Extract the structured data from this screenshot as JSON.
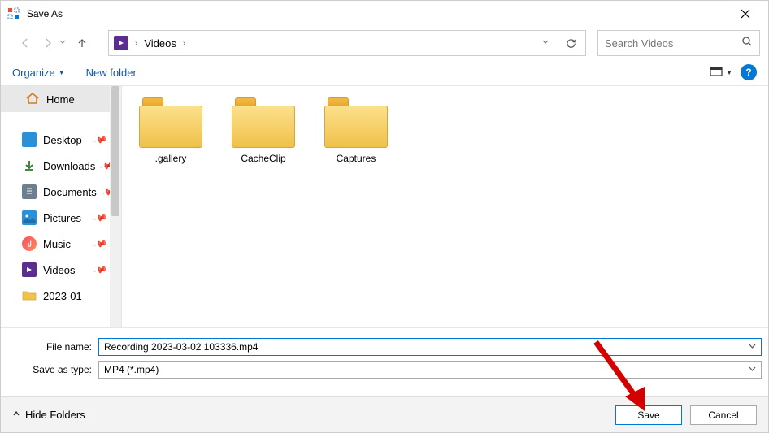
{
  "title": "Save As",
  "address": {
    "location": "Videos"
  },
  "search": {
    "placeholder": "Search Videos"
  },
  "toolbar": {
    "organize": "Organize",
    "newFolder": "New folder"
  },
  "sidebar": {
    "home": "Home",
    "items": [
      {
        "label": "Desktop"
      },
      {
        "label": "Downloads"
      },
      {
        "label": "Documents"
      },
      {
        "label": "Pictures"
      },
      {
        "label": "Music"
      },
      {
        "label": "Videos"
      },
      {
        "label": "2023-01"
      }
    ]
  },
  "grid": {
    "items": [
      {
        "label": ".gallery"
      },
      {
        "label": "CacheClip"
      },
      {
        "label": "Captures"
      }
    ]
  },
  "form": {
    "filenameLabel": "File name:",
    "filenameValue": "Recording 2023-03-02 103336.mp4",
    "typeLabel": "Save as type:",
    "typeValue": "MP4 (*.mp4)"
  },
  "footer": {
    "hideFolders": "Hide Folders",
    "save": "Save",
    "cancel": "Cancel"
  }
}
